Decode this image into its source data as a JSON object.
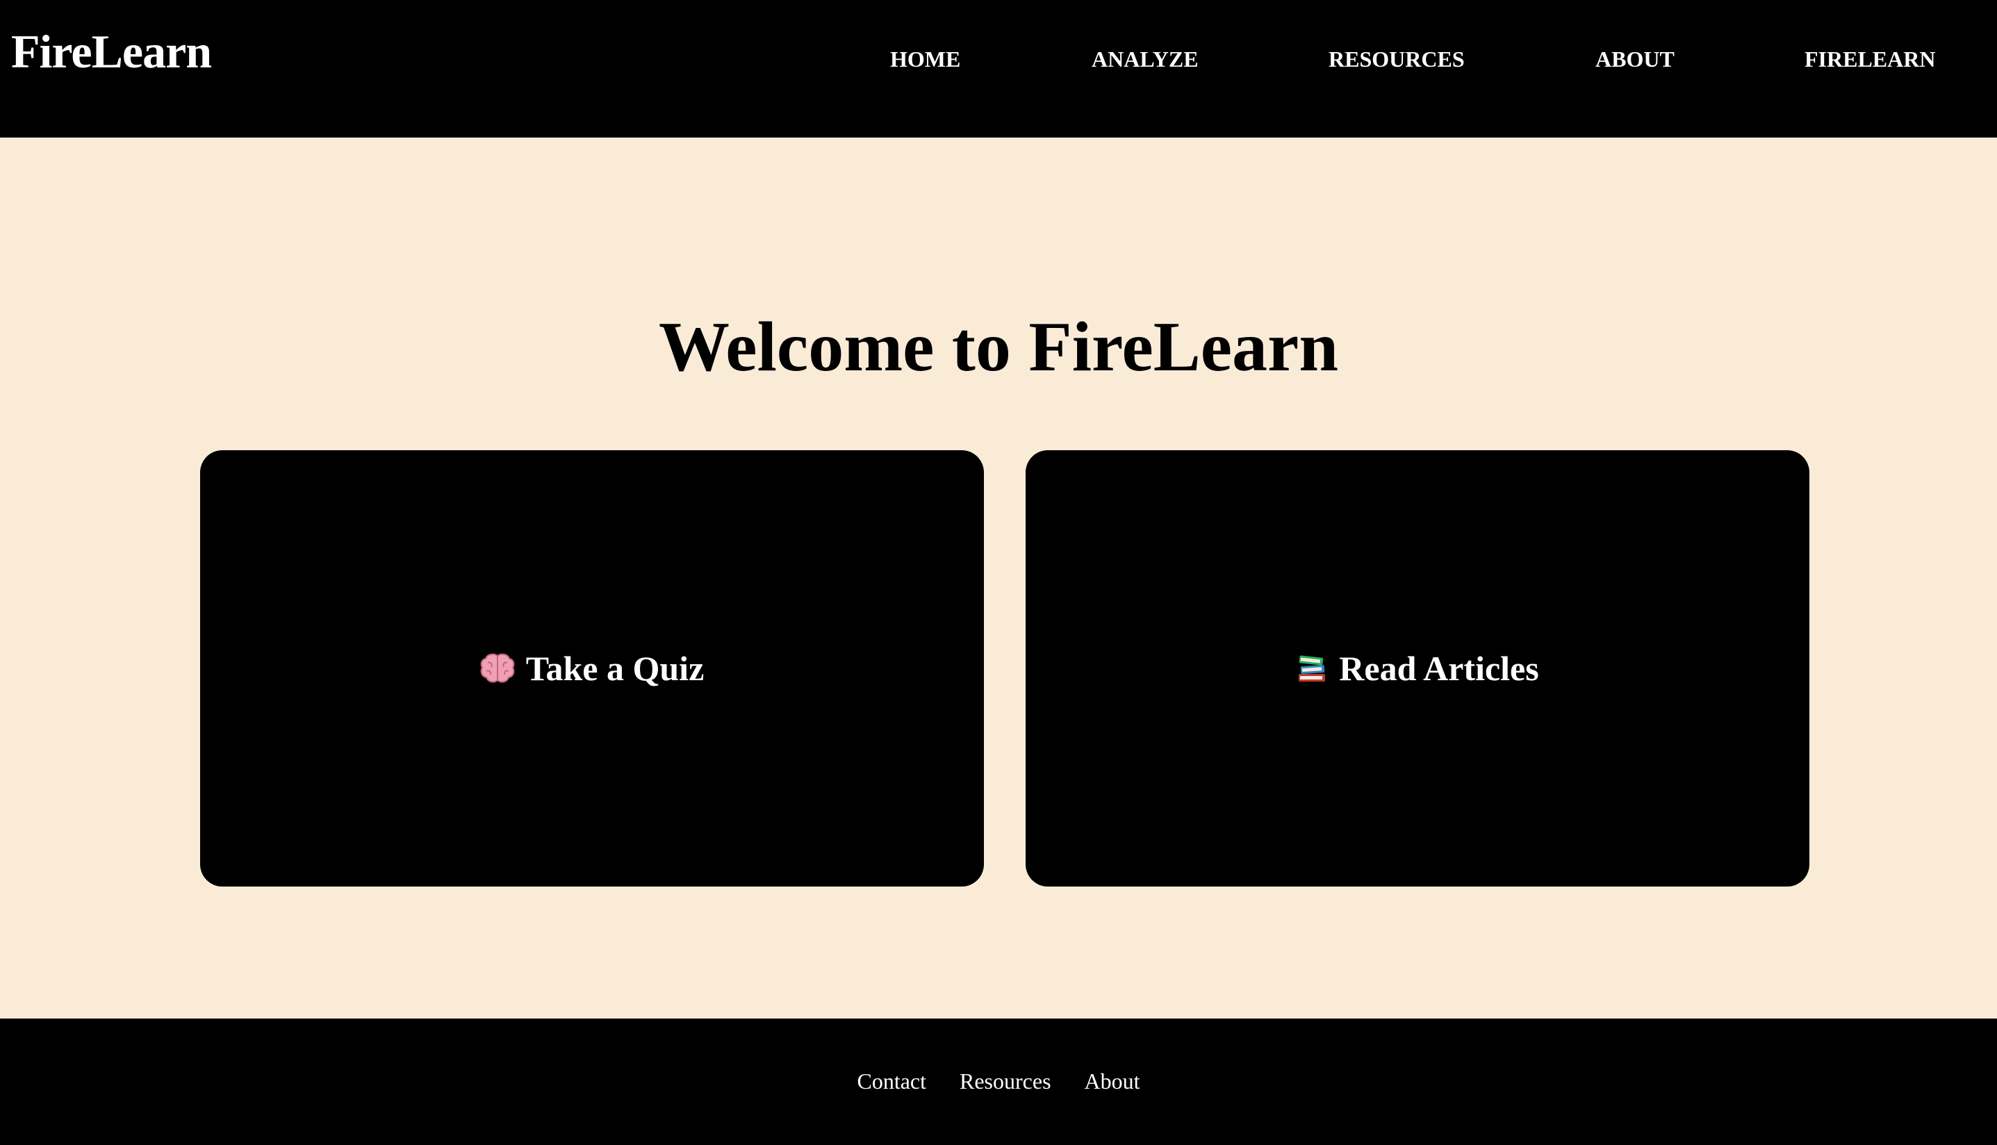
{
  "header": {
    "brand": "FireLearn",
    "nav": {
      "home": "HOME",
      "analyze": "ANALYZE",
      "resources": "RESOURCES",
      "about": "ABOUT",
      "firelearn": "FIRELEARN"
    }
  },
  "main": {
    "title": "Welcome to FireLearn",
    "cards": {
      "quiz": {
        "label": "Take a Quiz",
        "icon": "brain-icon"
      },
      "articles": {
        "label": "Read Articles",
        "icon": "books-icon"
      }
    }
  },
  "footer": {
    "links": {
      "contact": "Contact",
      "resources": "Resources",
      "about": "About"
    }
  },
  "colors": {
    "page_background": "#faebd7",
    "header_background": "#000000",
    "card_background": "#000000",
    "text_light": "#ffffff",
    "text_dark": "#000000"
  }
}
